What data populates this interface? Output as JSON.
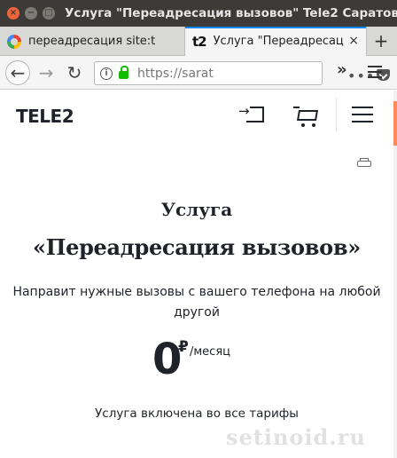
{
  "window": {
    "title": "Услуга \"Переадресация вызовов\" Tele2 Саратов",
    "close_glyph": "×",
    "min_glyph": "−",
    "max_glyph": "□"
  },
  "tabs": [
    {
      "label": "переадресация site:t",
      "icon": "google-icon"
    },
    {
      "label": "Услуга \"Переадресац",
      "icon": "tele2-icon",
      "favicon_text": "t2",
      "close_glyph": "×"
    }
  ],
  "new_tab_glyph": "+",
  "nav": {
    "back_glyph": "←",
    "forward_glyph": "→",
    "reload_glyph": "↻",
    "url": "https://sarat",
    "more_glyph": "•••",
    "star_glyph": "☆",
    "overflow_glyph": "»"
  },
  "site": {
    "logo": "TELE2",
    "accent_color": "#ff8a5c"
  },
  "content": {
    "kicker": "Услуга",
    "name": "«Переадресация вызовов»",
    "description": "Направит нужные вызовы с вашего телефона на любой другой",
    "price_value": "0",
    "price_currency": "₽",
    "price_period": "/месяц",
    "tariff_note": "Услуга включена во все тарифы"
  },
  "watermark": "setinoid.ru"
}
